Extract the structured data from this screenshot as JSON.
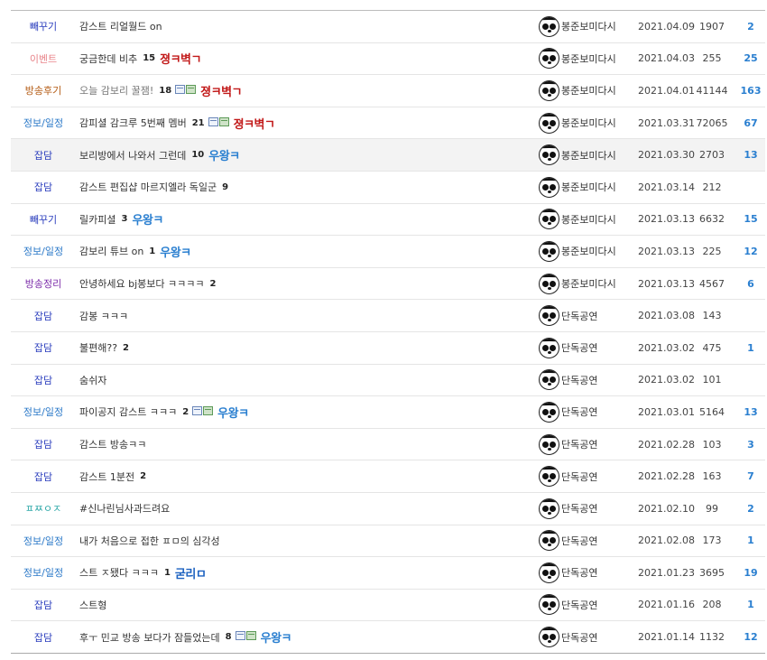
{
  "header": {
    "frag_a": "",
    "frag_b": ""
  },
  "colors": {
    "category_default": "#2a3dbd",
    "event": "#e8848a",
    "broadcast_review": "#b35a12",
    "info": "#2a78c8",
    "broadcast_sum": "#7a2aa8",
    "misc": "#2aa6a6",
    "likes": "#2a7fd0"
  },
  "posts": [
    {
      "category": "빼꾸기",
      "cat_color": "#2a3dbd",
      "title": "감스트 리얼월드 on",
      "title_gray": false,
      "count": "",
      "file_icons": false,
      "badge": "",
      "badge_class": "",
      "writer": "봉준보미다시",
      "date": "2021.04.09",
      "views": "1907",
      "likes": "2",
      "highlight": false
    },
    {
      "category": "이벤트",
      "cat_color": "#e8848a",
      "title": "궁금한데 비추",
      "title_gray": false,
      "count": "15",
      "file_icons": false,
      "badge": "졍ㅋ벽ㄱ",
      "badge_class": "b-red",
      "writer": "봉준보미다시",
      "date": "2021.04.03",
      "views": "255",
      "likes": "25",
      "highlight": false
    },
    {
      "category": "방송후기",
      "cat_color": "#b35a12",
      "title": "오늘 감보리 꿀잼!",
      "title_gray": true,
      "count": "18",
      "file_icons": true,
      "badge": "졍ㅋ벽ㄱ",
      "badge_class": "b-red",
      "writer": "봉준보미다시",
      "date": "2021.04.01",
      "views": "41144",
      "likes": "163",
      "highlight": false
    },
    {
      "category": "정보/일정",
      "cat_color": "#2a78c8",
      "title": "감피셜 감크루 5번째 멤버",
      "title_gray": false,
      "count": "21",
      "file_icons": true,
      "badge": "졍ㅋ벽ㄱ",
      "badge_class": "b-red",
      "writer": "봉준보미다시",
      "date": "2021.03.31",
      "views": "72065",
      "likes": "67",
      "highlight": false
    },
    {
      "category": "잡담",
      "cat_color": "#2a3dbd",
      "title": "보리방에서 나와서 그런데",
      "title_gray": false,
      "count": "10",
      "file_icons": false,
      "badge": "우왕ㅋ",
      "badge_class": "b-blue",
      "writer": "봉준보미다시",
      "date": "2021.03.30",
      "views": "2703",
      "likes": "13",
      "highlight": true
    },
    {
      "category": "잡담",
      "cat_color": "#2a3dbd",
      "title": "감스트 편집샵 마르지엘라 독일군",
      "title_gray": false,
      "count": "9",
      "file_icons": false,
      "badge": "",
      "badge_class": "",
      "writer": "봉준보미다시",
      "date": "2021.03.14",
      "views": "212",
      "likes": "",
      "highlight": false
    },
    {
      "category": "빼꾸기",
      "cat_color": "#2a3dbd",
      "title": "릴카피셜",
      "title_gray": false,
      "count": "3",
      "file_icons": false,
      "badge": "우왕ㅋ",
      "badge_class": "b-blue",
      "writer": "봉준보미다시",
      "date": "2021.03.13",
      "views": "6632",
      "likes": "15",
      "highlight": false
    },
    {
      "category": "정보/일정",
      "cat_color": "#2a78c8",
      "title": "감보리 튜브 on",
      "title_gray": false,
      "count": "1",
      "file_icons": false,
      "badge": "우왕ㅋ",
      "badge_class": "b-blue",
      "writer": "봉준보미다시",
      "date": "2021.03.13",
      "views": "225",
      "likes": "12",
      "highlight": false
    },
    {
      "category": "방송정리",
      "cat_color": "#7a2aa8",
      "title": "안녕하세요 bj봉보다 ㅋㅋㅋㅋ",
      "title_gray": false,
      "count": "2",
      "file_icons": false,
      "badge": "",
      "badge_class": "",
      "writer": "봉준보미다시",
      "date": "2021.03.13",
      "views": "4567",
      "likes": "6",
      "highlight": false
    },
    {
      "category": "잡담",
      "cat_color": "#2a3dbd",
      "title": "감봉 ㅋㅋㅋ",
      "title_gray": false,
      "count": "",
      "file_icons": false,
      "badge": "",
      "badge_class": "",
      "writer": "단독공연",
      "date": "2021.03.08",
      "views": "143",
      "likes": "",
      "highlight": false
    },
    {
      "category": "잡담",
      "cat_color": "#2a3dbd",
      "title": "불편해??",
      "title_gray": false,
      "count": "2",
      "file_icons": false,
      "badge": "",
      "badge_class": "",
      "writer": "단독공연",
      "date": "2021.03.02",
      "views": "475",
      "likes": "1",
      "highlight": false
    },
    {
      "category": "잡담",
      "cat_color": "#2a3dbd",
      "title": "숨쉬자",
      "title_gray": false,
      "count": "",
      "file_icons": false,
      "badge": "",
      "badge_class": "",
      "writer": "단독공연",
      "date": "2021.03.02",
      "views": "101",
      "likes": "",
      "highlight": false
    },
    {
      "category": "정보/일정",
      "cat_color": "#2a78c8",
      "title": "파이공지 감스트 ㅋㅋㅋ",
      "title_gray": false,
      "count": "2",
      "file_icons": true,
      "badge": "우왕ㅋ",
      "badge_class": "b-blue",
      "writer": "단독공연",
      "date": "2021.03.01",
      "views": "5164",
      "likes": "13",
      "highlight": false
    },
    {
      "category": "잡담",
      "cat_color": "#2a3dbd",
      "title": "감스트 방송ㅋㅋ",
      "title_gray": false,
      "count": "",
      "file_icons": false,
      "badge": "",
      "badge_class": "",
      "writer": "단독공연",
      "date": "2021.02.28",
      "views": "103",
      "likes": "3",
      "highlight": false
    },
    {
      "category": "잡담",
      "cat_color": "#2a3dbd",
      "title": "감스트 1분전",
      "title_gray": false,
      "count": "2",
      "file_icons": false,
      "badge": "",
      "badge_class": "",
      "writer": "단독공연",
      "date": "2021.02.28",
      "views": "163",
      "likes": "7",
      "highlight": false
    },
    {
      "category": "ㅍㅉㅇㅈ",
      "cat_color": "#2aa6a6",
      "title": "#신나린님사과드려요",
      "title_gray": false,
      "count": "",
      "file_icons": false,
      "badge": "",
      "badge_class": "",
      "writer": "단독공연",
      "date": "2021.02.10",
      "views": "99",
      "likes": "2",
      "highlight": false
    },
    {
      "category": "정보/일정",
      "cat_color": "#2a78c8",
      "title": "내가 처음으로 접한 ㅍㅁ의 심각성",
      "title_gray": false,
      "count": "",
      "file_icons": false,
      "badge": "",
      "badge_class": "",
      "writer": "단독공연",
      "date": "2021.02.08",
      "views": "173",
      "likes": "1",
      "highlight": false
    },
    {
      "category": "정보/일정",
      "cat_color": "#2a78c8",
      "title": "스트 ㅈ됐다 ㅋㅋㅋ",
      "title_gray": false,
      "count": "1",
      "file_icons": false,
      "badge": "굳리ㅁ",
      "badge_class": "b-navy",
      "writer": "단독공연",
      "date": "2021.01.23",
      "views": "3695",
      "likes": "19",
      "highlight": false
    },
    {
      "category": "잡담",
      "cat_color": "#2a3dbd",
      "title": "스트형",
      "title_gray": false,
      "count": "",
      "file_icons": false,
      "badge": "",
      "badge_class": "",
      "writer": "단독공연",
      "date": "2021.01.16",
      "views": "208",
      "likes": "1",
      "highlight": false
    },
    {
      "category": "잡담",
      "cat_color": "#2a3dbd",
      "title": "후ㅜ 민교 방송 보다가 잠들었는데",
      "title_gray": false,
      "count": "8",
      "file_icons": true,
      "badge": "우왕ㅋ",
      "badge_class": "b-blue",
      "writer": "단독공연",
      "date": "2021.01.14",
      "views": "1132",
      "likes": "12",
      "highlight": false
    }
  ]
}
